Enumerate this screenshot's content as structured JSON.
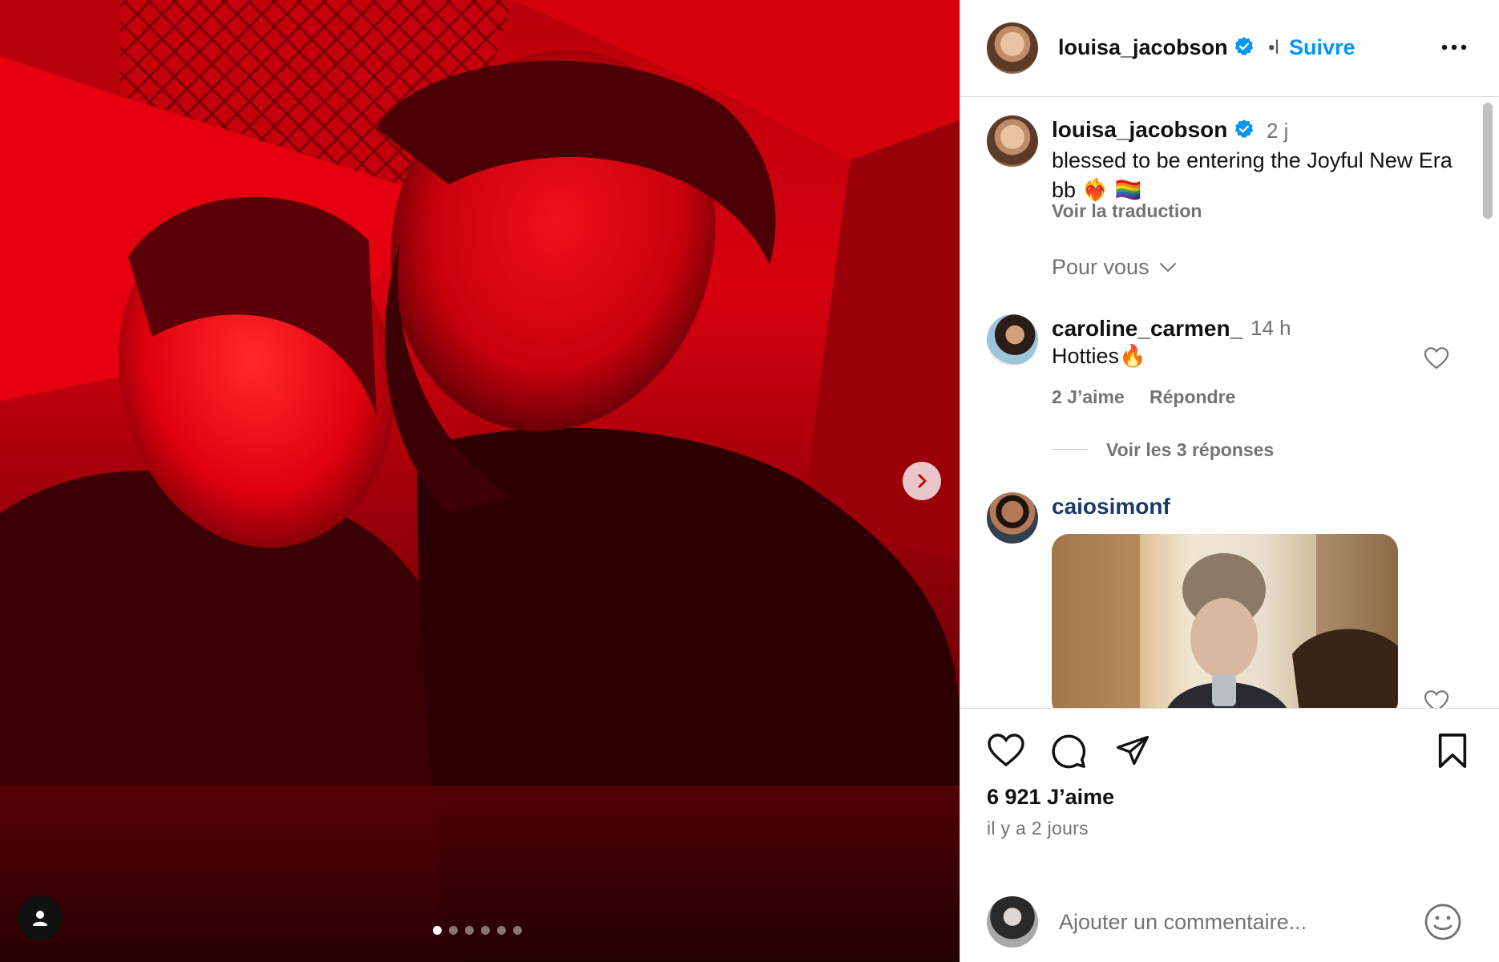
{
  "post": {
    "author": "louisa_jacobson",
    "follow_label": "Suivre",
    "separator": "•l",
    "carousel": {
      "total": 6,
      "active": 1
    }
  },
  "caption": {
    "user": "louisa_jacobson",
    "time": "2 j",
    "text": "blessed to be entering the Joyful New Era bb ❤️‍🔥 🏳️‍🌈",
    "translate_label": "Voir la traduction"
  },
  "sort": {
    "label": "Pour vous"
  },
  "comments": [
    {
      "user": "caroline_carmen_",
      "time": "14 h",
      "text": "Hotties🔥",
      "likes_label": "2 J’aime",
      "reply_label": "Répondre",
      "replies_label": "Voir les 3 réponses"
    },
    {
      "user": "caiosimonf"
    }
  ],
  "engagement": {
    "likes": "6 921 J’aime",
    "date": "il y a 2 jours"
  },
  "composer": {
    "placeholder": "Ajouter un commentaire..."
  },
  "colors": {
    "accent": "#0095f6",
    "muted": "#737373",
    "verified": "#0095f6"
  }
}
